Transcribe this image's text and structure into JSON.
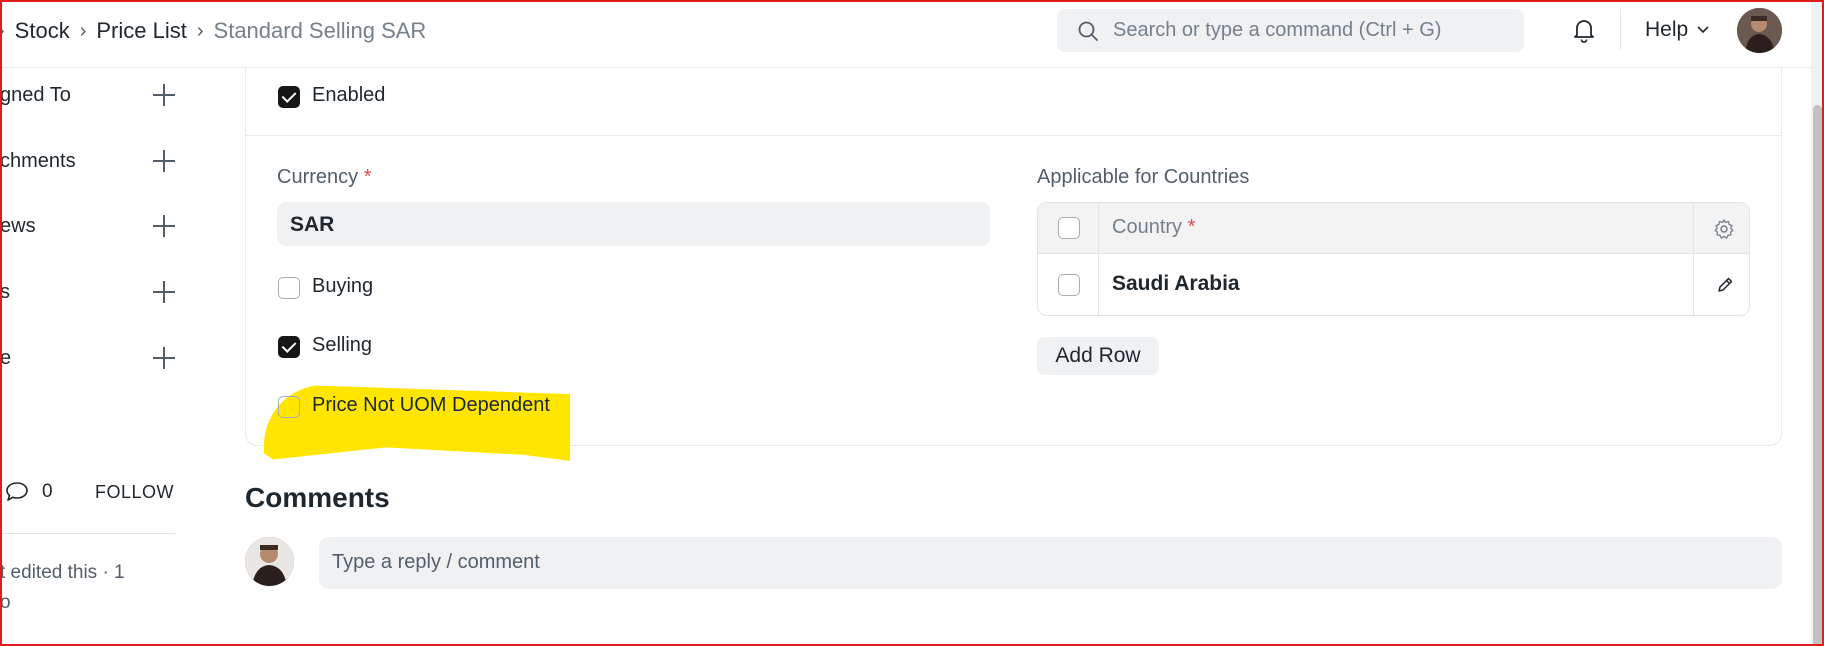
{
  "breadcrumb": {
    "items": [
      "Stock",
      "Price List"
    ],
    "current": "Standard Selling SAR"
  },
  "navbar": {
    "search_placeholder": "Search or type a command (Ctrl + G)",
    "help_label": "Help"
  },
  "sidebar": {
    "items": [
      {
        "label": "gned To"
      },
      {
        "label": "chments"
      },
      {
        "label": "ews"
      },
      {
        "label": "s"
      },
      {
        "label": "e"
      }
    ],
    "comment_count": "0",
    "follow_label": "FOLLOW",
    "activity_line1": "t edited this · 1",
    "activity_line2": "o"
  },
  "form": {
    "enabled": {
      "label": "Enabled",
      "checked": true
    },
    "currency": {
      "label": "Currency",
      "required_mark": "*",
      "value": "SAR"
    },
    "buying": {
      "label": "Buying",
      "checked": false
    },
    "selling": {
      "label": "Selling",
      "checked": true
    },
    "price_not_uom_dependent": {
      "label": "Price Not UOM Dependent",
      "checked": false
    },
    "countries": {
      "label": "Applicable for Countries",
      "column_header": "Country",
      "required_mark": "*",
      "rows": [
        {
          "country": "Saudi Arabia"
        }
      ],
      "add_row_label": "Add Row"
    }
  },
  "comments": {
    "title": "Comments",
    "placeholder": "Type a reply / comment"
  },
  "colors": {
    "highlight": "#ffe500",
    "required": "#e24c4c",
    "frame": "#e01c1c"
  }
}
